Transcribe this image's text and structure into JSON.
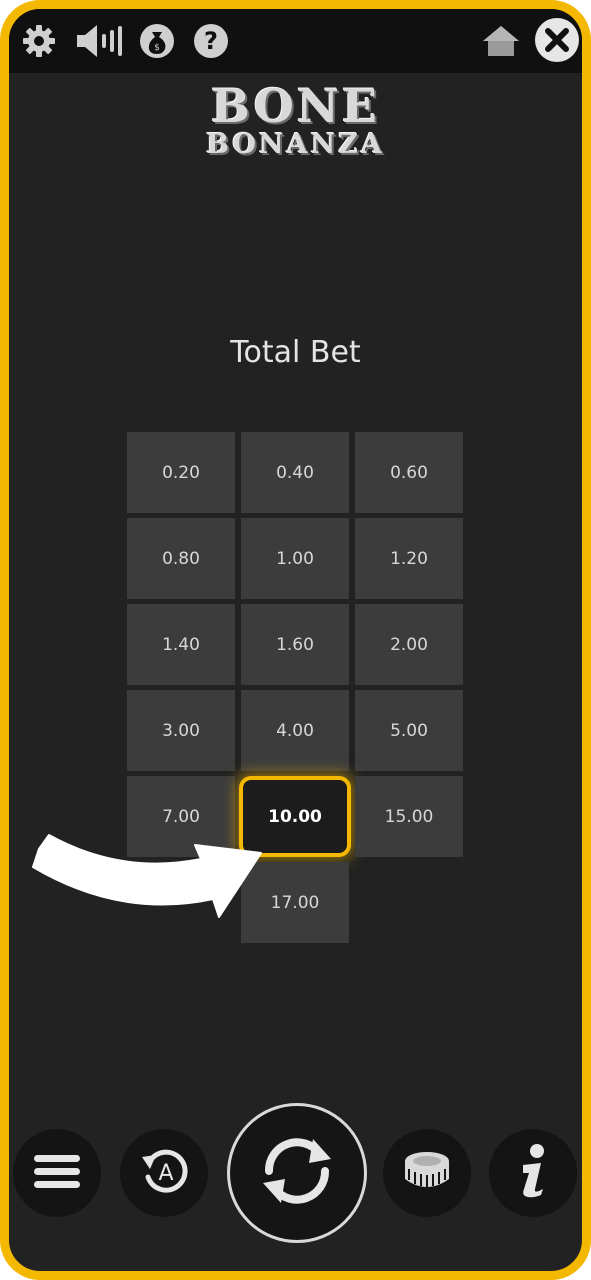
{
  "topbar": {
    "icons": [
      "gear-icon",
      "speaker-icon",
      "money-bag-icon",
      "help-icon",
      "home-icon",
      "close-icon"
    ]
  },
  "logo": {
    "line1": "BONE",
    "line2": "BONANZA"
  },
  "bet_panel": {
    "title": "Total Bet",
    "options": [
      "0.20",
      "0.40",
      "0.60",
      "0.80",
      "1.00",
      "1.20",
      "1.40",
      "1.60",
      "2.00",
      "3.00",
      "4.00",
      "5.00",
      "7.00",
      "10.00",
      "15.00",
      "17.00"
    ],
    "selected": "10.00"
  },
  "bottombar": {
    "icons": [
      "menu-icon",
      "autoplay-icon",
      "spin-icon",
      "coins-icon",
      "info-icon"
    ]
  },
  "colors": {
    "accent": "#f5b800",
    "background": "#222222",
    "cell": "#3c3c3c"
  }
}
